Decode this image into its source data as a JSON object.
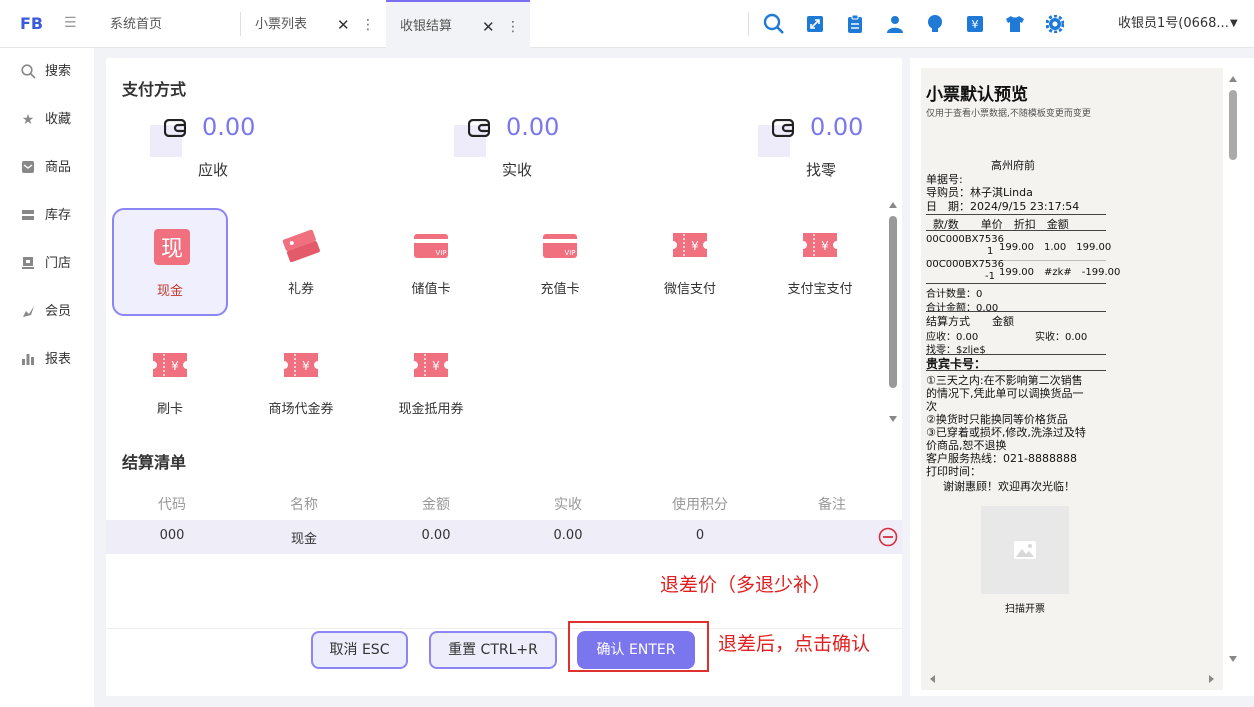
{
  "app": {
    "logo": "FB"
  },
  "tabs": [
    {
      "label": "系统首页"
    },
    {
      "label": "小票列表"
    },
    {
      "label": "收银结算"
    }
  ],
  "user": {
    "name": "收银员1号(0668..."
  },
  "colors": {
    "accent": "#7b78ee",
    "accent_border": "#8b85f5",
    "pay_icon": "#f07080",
    "annotation": "#e02020",
    "topbar_icon": "#1e7ad6"
  },
  "topbar_icons": [
    "search-icon",
    "expand-icon",
    "clipboard-icon",
    "user-icon",
    "bulb-icon",
    "cashier-icon",
    "shirt-icon",
    "gear-icon"
  ],
  "sidebar": {
    "items": [
      {
        "label": "搜索",
        "icon": "search-icon"
      },
      {
        "label": "收藏",
        "icon": "star-icon"
      },
      {
        "label": "商品",
        "icon": "goods-icon"
      },
      {
        "label": "库存",
        "icon": "inventory-icon"
      },
      {
        "label": "门店",
        "icon": "store-icon"
      },
      {
        "label": "会员",
        "icon": "member-icon"
      },
      {
        "label": "报表",
        "icon": "report-icon"
      }
    ]
  },
  "payment": {
    "title": "支付方式",
    "stats": [
      {
        "value": "0.00",
        "label": "应收"
      },
      {
        "value": "0.00",
        "label": "实收"
      },
      {
        "value": "0.00",
        "label": "找零"
      }
    ],
    "methods": [
      {
        "label": "现金",
        "icon_text": "现"
      },
      {
        "label": "礼券"
      },
      {
        "label": "储值卡"
      },
      {
        "label": "充值卡"
      },
      {
        "label": "微信支付"
      },
      {
        "label": "支付宝支付"
      },
      {
        "label": "刷卡"
      },
      {
        "label": "商场代金券"
      },
      {
        "label": "现金抵用券"
      }
    ],
    "selected": "现金"
  },
  "settlement": {
    "title": "结算清单",
    "columns": [
      "代码",
      "名称",
      "金额",
      "实收",
      "使用积分",
      "备注"
    ],
    "rows": [
      [
        "000",
        "现金",
        "0.00",
        "0.00",
        "0",
        ""
      ]
    ]
  },
  "buttons": {
    "cancel": "取消 ESC",
    "reset": "重置 CTRL+R",
    "confirm": "确认 ENTER"
  },
  "annotations": {
    "note1": "退差价（多退少补）",
    "note2": "退差后，点击确认"
  },
  "receipt": {
    "title": "小票默认预览",
    "subtitle": "仅用于查看小票数据,不随模板变更而变更",
    "store": "高州府前",
    "doc_no": "单据号:",
    "guide": "导购员：林子淇Linda",
    "date": "日　期：2024/9/15 23:17:54",
    "header": "款/数　　单价　折扣　金额",
    "item1_code": "00C000BX7536",
    "item1_qty": "1",
    "item1_vals": "199.00　1.00　199.00",
    "item2_code": "00C000BX7536",
    "item2_qty": "-1",
    "item2_vals": "199.00　#zk#　-199.00",
    "total_qty": "合计数量：0",
    "total_amt": "合计金额：0.00",
    "pay_hdr": "结算方式　　金额",
    "recv": "应收：0.00",
    "paid": "实收：0.00",
    "change": "找零：$zlje$",
    "vip": "贵宾卡号：",
    "policy1": "①三天之内:在不影响第二次销售",
    "policy2": "的情况下,凭此单可以调换货品一",
    "policy3": "次",
    "policy4": "②换货时只能换同等价格货品",
    "policy5": "③已穿着或损坏,修改,洗涤过及特",
    "policy6": "价商品,恕不退换",
    "hotline": "客户服务热线：021-8888888",
    "print_time": "打印时间：",
    "thanks": "谢谢惠顾！欢迎再次光临！",
    "qr_label": "扫描开票"
  }
}
